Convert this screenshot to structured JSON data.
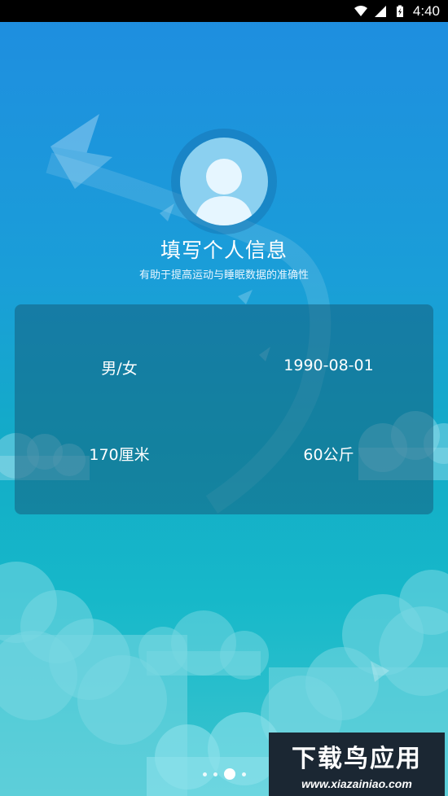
{
  "status_bar": {
    "time": "4:40",
    "icons": [
      "wifi-icon",
      "signal-icon",
      "battery-icon"
    ]
  },
  "profile": {
    "title": "填写个人信息",
    "subtitle": "有助于提高运动与睡眠数据的准确性"
  },
  "fields": {
    "gender": "男/女",
    "birthday": "1990-08-01",
    "height": "170厘米",
    "weight": "60公斤"
  },
  "pager": {
    "pages": 4,
    "current": 3
  },
  "watermark": {
    "brand": "下载鸟应用",
    "url": "www.xiazainiao.com"
  }
}
